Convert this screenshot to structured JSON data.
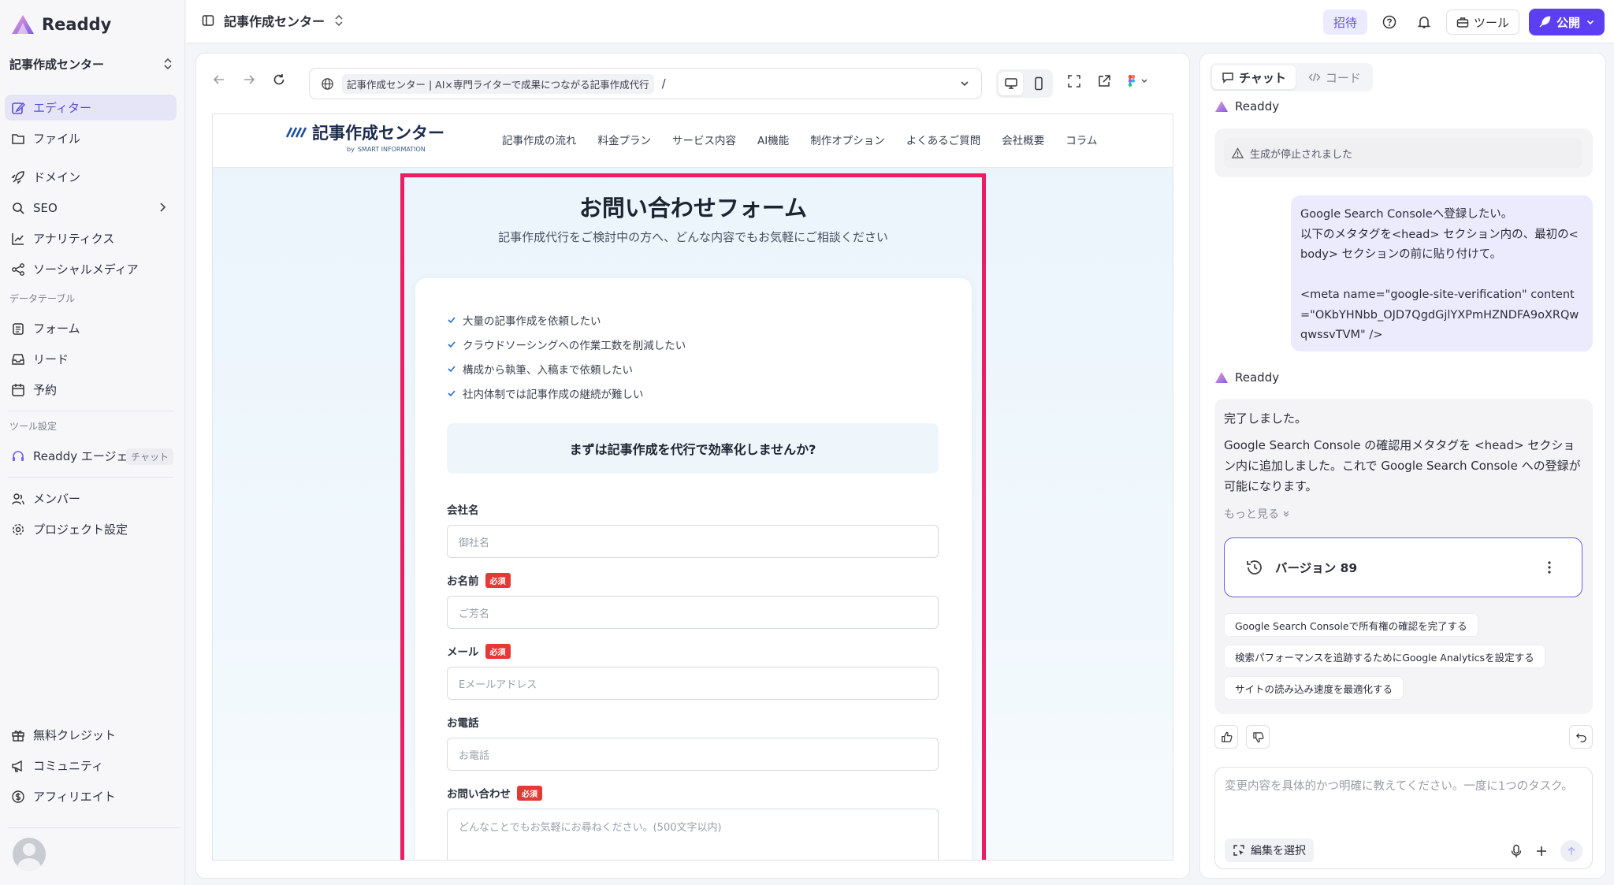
{
  "app": {
    "brand": "Readdy",
    "project_name": "記事作成センター",
    "accent": "#5b3ff0",
    "highlight_border": "#e91e63"
  },
  "sidebar": {
    "items_top": [
      {
        "label": "エディター",
        "icon": "edit-icon",
        "active": true
      },
      {
        "label": "ファイル",
        "icon": "folder-icon"
      }
    ],
    "items_site": [
      {
        "label": "ドメイン",
        "icon": "rocket-icon"
      },
      {
        "label": "SEO",
        "icon": "search-icon"
      },
      {
        "label": "アナリティクス",
        "icon": "chart-icon"
      },
      {
        "label": "ソーシャルメディア",
        "icon": "share-icon"
      }
    ],
    "data_section_label": "データテーブル",
    "items_data": [
      {
        "label": "フォーム",
        "icon": "clipboard-icon"
      },
      {
        "label": "リード",
        "icon": "inbox-icon"
      },
      {
        "label": "予約",
        "icon": "calendar-icon"
      }
    ],
    "tools_section_label": "ツール設定",
    "agent_item": {
      "label": "Readdy エージェン",
      "badge": "チャット"
    },
    "items_team": [
      {
        "label": "メンバー",
        "icon": "users-icon"
      },
      {
        "label": "プロジェクト設定",
        "icon": "gear-icon"
      }
    ],
    "items_bottom": [
      {
        "label": "無料クレジット",
        "icon": "gift-icon"
      },
      {
        "label": "コミュニティ",
        "icon": "megaphone-icon"
      },
      {
        "label": "アフィリエイト",
        "icon": "dollar-icon"
      }
    ]
  },
  "topbar": {
    "title": "記事作成センター",
    "invite_label": "招待",
    "tools_label": "ツール",
    "publish_label": "公開"
  },
  "browser": {
    "url_title": "記事作成センター | AI×専門ライターで成果につながる記事作成代行",
    "url_path": "/"
  },
  "site": {
    "logo_name": "記事作成センター",
    "logo_by": "by",
    "logo_company": "SMART INFORMATION",
    "nav": [
      "記事作成の流れ",
      "料金プラン",
      "サービス内容",
      "AI機能",
      "制作オプション",
      "よくあるご質問",
      "会社概要",
      "コラム"
    ],
    "form_title": "お問い合わせフォーム",
    "form_subtitle": "記事作成代行をご検討中の方へ、どんな内容でもお気軽にご相談ください",
    "checks": [
      "大量の記事作成を依頼したい",
      "クラウドソーシングへの作業工数を削減したい",
      "構成から執筆、入稿まで依頼したい",
      "社内体制では記事作成の継続が難しい"
    ],
    "cta": "まずは記事作成を代行で効率化しませんか?",
    "required_label": "必須",
    "fields": {
      "company": {
        "label": "会社名",
        "placeholder": "御社名"
      },
      "name": {
        "label": "お名前",
        "placeholder": "ご芳名"
      },
      "email": {
        "label": "メール",
        "placeholder": "Eメールアドレス"
      },
      "phone": {
        "label": "お電話",
        "placeholder": "お電話"
      },
      "inquiry": {
        "label": "お問い合わせ",
        "placeholder": "どんなことでもお気軽にお尋ねください。(500文字以内)"
      }
    }
  },
  "chat": {
    "tab_chat": "チャット",
    "tab_code": "コード",
    "sender_ai": "Readdy",
    "stopped_text": "生成が停止されました",
    "user_message": "Google Search Consoleへ登録したい。\n以下のメタタグを<head> セクション内の、最初の<body> セクションの前に貼り付けて。\n\n<meta name=\"google-site-verification\" content=\"OKbYHNbb_OJD7QgdGjlYXPmHZNDFA9oXRQwqwssvTVM\" />",
    "ai_done": "完了しました。",
    "ai_detail": "Google Search Console の確認用メタタグを <head> セクション内に追加しました。これで Google Search Console への登録が可能になります。",
    "more_label": "もっと見る",
    "version_label": "バージョン 89",
    "suggestions": [
      "Google Search Consoleで所有権の確認を完了する",
      "検索パフォーマンスを追跡するためにGoogle Analyticsを設定する",
      "サイトの読み込み速度を最適化する"
    ],
    "composer_placeholder": "変更内容を具体的かつ明確に教えてください。一度に1つのタスク。",
    "select_edit_label": "編集を選択"
  }
}
